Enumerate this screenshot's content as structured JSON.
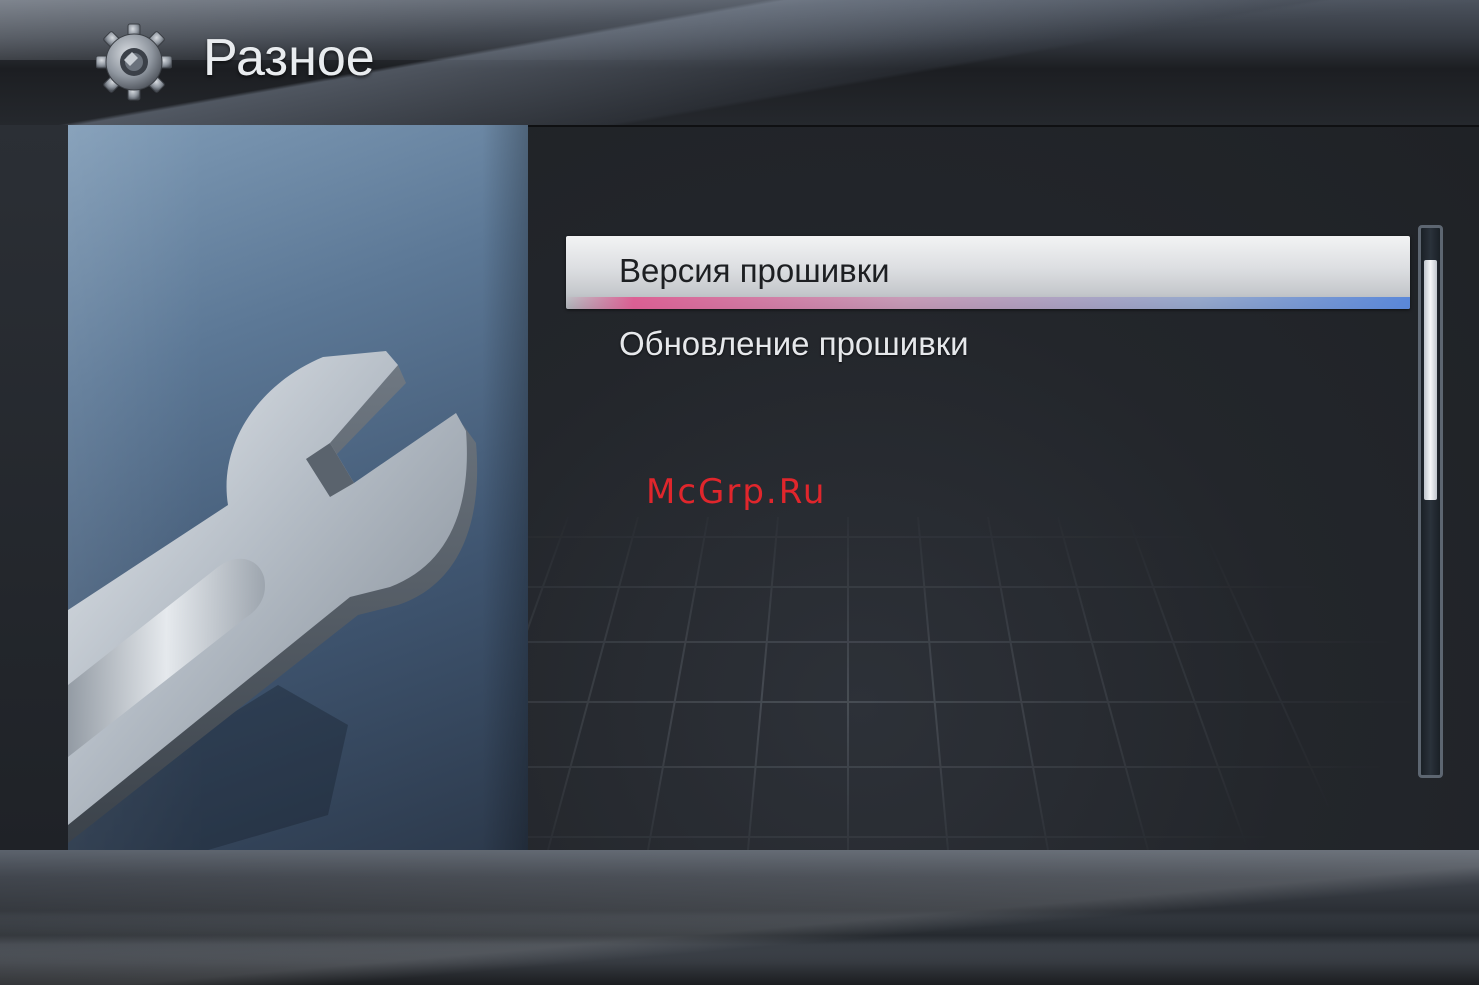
{
  "header": {
    "title": "Разное",
    "icon": "gear-icon"
  },
  "menu": {
    "items": [
      {
        "label": "Версия прошивки",
        "selected": true
      },
      {
        "label": "Обновление прошивки",
        "selected": false
      }
    ]
  },
  "scrollbar": {
    "position": 0
  },
  "watermark": {
    "text": "McGrp.Ru"
  },
  "art": {
    "icon": "wrench-icon"
  },
  "colors": {
    "accent_pink": "#e1508c",
    "accent_blue": "#5082dc",
    "watermark_red": "#e0262c"
  }
}
